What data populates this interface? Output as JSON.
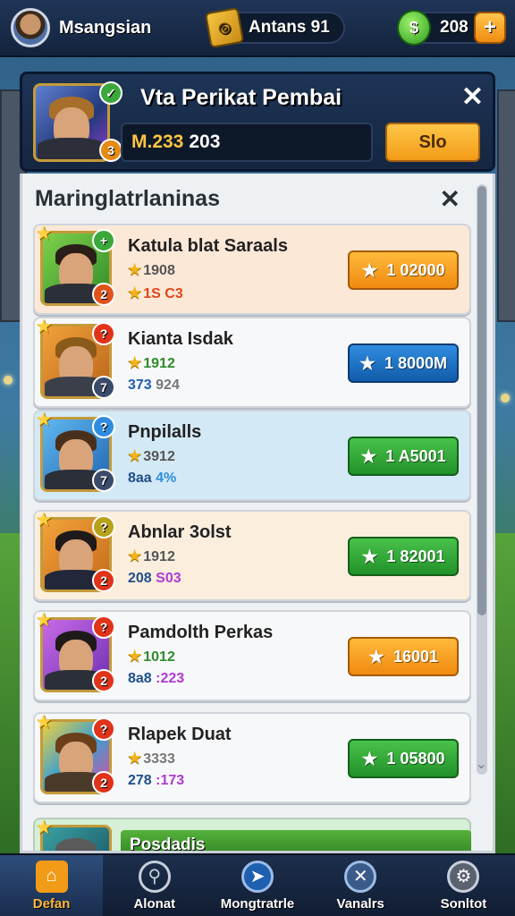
{
  "topbar": {
    "player_name": "Msangsian",
    "tickets_label": "Antans 91",
    "cash_value": "208",
    "plus_symbol": "+"
  },
  "header": {
    "title": "Vta Perikat Pembai",
    "close_symbol": "✕",
    "field_gold": "M.233",
    "field_white": "203",
    "button_label": "Slo",
    "portrait_badge_top": "✓",
    "portrait_badge_bottom": "3"
  },
  "list": {
    "title": "Maringlatrlaninas",
    "close_symbol": "✕",
    "items": [
      {
        "name": "Katula blat Saraals",
        "stat1": "1908",
        "stat2_a": "1S",
        "stat2_b": "C3",
        "price": "1 02000",
        "button_color": "orange",
        "level": "2",
        "badge": "+"
      },
      {
        "name": "Kianta Isdak",
        "stat1": "1912",
        "stat2_a": "373",
        "stat2_b": "924",
        "price": "1 8000M",
        "button_color": "blue",
        "level": "7",
        "badge": "?"
      },
      {
        "name": "Pnpilalls",
        "stat1": "3912",
        "stat2_a": "8aa",
        "stat2_b": "4%",
        "price": "1 A5001",
        "button_color": "green",
        "level": "7",
        "badge": "?"
      },
      {
        "name": "Abnlar 3olst",
        "stat1": "1912",
        "stat2_a": "208",
        "stat2_b": "S03",
        "price": "1 82001",
        "button_color": "green",
        "level": "2",
        "badge": "?"
      },
      {
        "name": "Pamdolth Perkas",
        "stat1": "1012",
        "stat2_a": "8a8",
        "stat2_b": ":223",
        "price": "16001",
        "button_color": "orange",
        "level": "2",
        "badge": "?"
      },
      {
        "name": "Rlapek Duat",
        "stat1": "3333",
        "stat2_a": "278",
        "stat2_b": ":173",
        "price": "1 05800",
        "button_color": "green",
        "level": "2",
        "badge": "?"
      }
    ],
    "partial_item": {
      "name": "Posdadis"
    }
  },
  "nav": {
    "items": [
      {
        "label": "Defan",
        "icon": "home-icon"
      },
      {
        "label": "Alonat",
        "icon": "search-icon"
      },
      {
        "label": "Mongtratrle",
        "icon": "compass-icon"
      },
      {
        "label": "Vanalrs",
        "icon": "shield-icon"
      },
      {
        "label": "Sonltot",
        "icon": "gear-icon"
      }
    ]
  },
  "colors": {
    "orange_button": "#f08a10",
    "blue_button": "#125ba9",
    "green_button": "#22912a",
    "gold_text": "#ffc542"
  }
}
